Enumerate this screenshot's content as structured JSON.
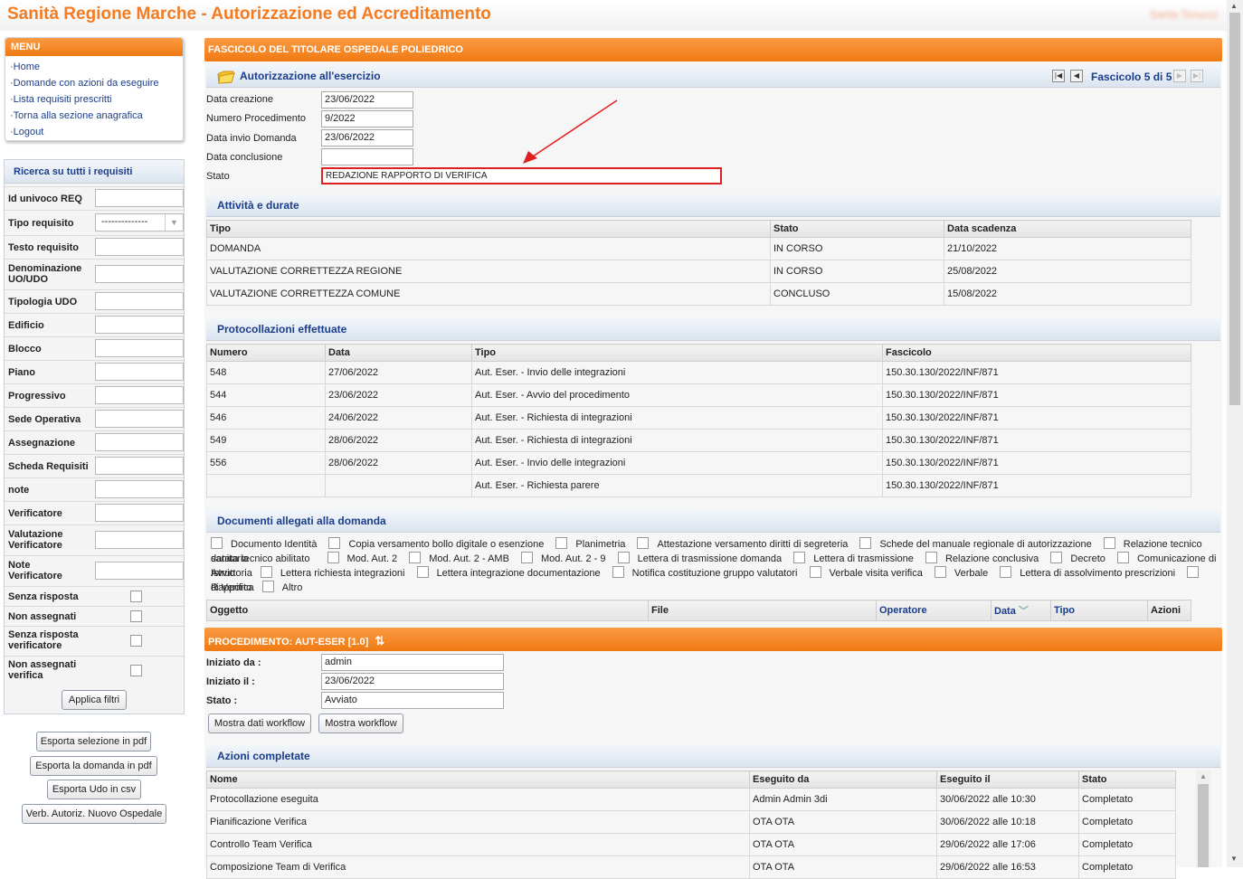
{
  "app": {
    "title": "Sanità Regione Marche - Autorizzazione ed Accreditamento",
    "user": "Santa Tonucci"
  },
  "menu": {
    "title": "MENU",
    "items": [
      "Home",
      "Domande con azioni da eseguire",
      "Lista requisiti prescritti",
      "Torna alla sezione anagrafica",
      "Logout"
    ]
  },
  "filters": {
    "title": "Ricerca su tutti i requisiti",
    "fields": [
      "Id univoco REQ",
      "Tipo requisito",
      "Testo requisito",
      "Denominazione UO/UDO",
      "Tipologia UDO",
      "Edificio",
      "Blocco",
      "Piano",
      "Progressivo",
      "Sede Operativa",
      "Assegnazione",
      "Scheda Requisiti",
      "note",
      "Verificatore",
      "Valutazione Verificatore",
      "Note Verificatore"
    ],
    "tipo_requisito_value": "--------------",
    "checks": [
      "Senza risposta",
      "Non assegnati",
      "Senza risposta verificatore",
      "Non assegnati verifica"
    ],
    "apply": "Applica filtri"
  },
  "side_buttons": [
    "Esporta selezione in pdf",
    "Esporta la domanda in pdf",
    "Esporta Udo in csv",
    "Verb. Autoriz. Nuovo Ospedale"
  ],
  "fascicolo": {
    "title": "FASCICOLO DEL TITOLARE OSPEDALE POLIEDRICO",
    "section": "Autorizzazione all'esercizio",
    "pager": "Fascicolo 5 di 5",
    "fields": [
      {
        "label": "Data creazione",
        "value": "23/06/2022"
      },
      {
        "label": "Numero Procedimento",
        "value": "9/2022"
      },
      {
        "label": "Data invio Domanda",
        "value": "23/06/2022"
      },
      {
        "label": "Data conclusione",
        "value": ""
      },
      {
        "label": "Stato",
        "value": "REDAZIONE RAPPORTO DI VERIFICA"
      }
    ]
  },
  "attivita": {
    "title": "Attività e durate",
    "columns": [
      "Tipo",
      "Stato",
      "Data scadenza"
    ],
    "rows": [
      [
        "DOMANDA",
        "IN CORSO",
        "21/10/2022"
      ],
      [
        "VALUTAZIONE CORRETTEZZA REGIONE",
        "IN CORSO",
        "25/08/2022"
      ],
      [
        "VALUTAZIONE CORRETTEZZA COMUNE",
        "CONCLUSO",
        "15/08/2022"
      ]
    ]
  },
  "protocollazioni": {
    "title": "Protocollazioni effettuate",
    "columns": [
      "Numero",
      "Data",
      "Tipo",
      "Fascicolo"
    ],
    "rows": [
      [
        "548",
        "27/06/2022",
        "Aut. Eser. - Invio delle integrazioni",
        "150.30.130/2022/INF/871"
      ],
      [
        "544",
        "23/06/2022",
        "Aut. Eser. - Avvio del procedimento",
        "150.30.130/2022/INF/871"
      ],
      [
        "546",
        "24/06/2022",
        "Aut. Eser. - Richiesta di integrazioni",
        "150.30.130/2022/INF/871"
      ],
      [
        "549",
        "28/06/2022",
        "Aut. Eser. - Richiesta di integrazioni",
        "150.30.130/2022/INF/871"
      ],
      [
        "556",
        "28/06/2022",
        "Aut. Eser. - Invio delle integrazioni",
        "150.30.130/2022/INF/871"
      ],
      [
        "",
        "",
        "Aut. Eser. - Richiesta parere",
        "150.30.130/2022/INF/871"
      ]
    ]
  },
  "documenti": {
    "title": "Documenti allegati alla domanda",
    "lines": [
      {
        "prefix": "",
        "items": [
          "Documento Identità",
          "Copia versamento bollo digitale o esenzione",
          "Planimetria",
          "Attestazione versamento diritti di segreteria",
          "Schede del manuale regionale di autorizzazione",
          "Relazione tecnico sanitaria"
        ]
      },
      {
        "prefix": "datata tecnico abilitato",
        "items": [
          "Mod. Aut. 2",
          "Mod. Aut. 2 - AMB",
          "Mod. Aut. 2 - 9",
          "Lettera di trasmissione domanda",
          "Lettera di trasmissione",
          "Relazione conclusiva",
          "Decreto",
          "Comunicazione di Avvio"
        ]
      },
      {
        "prefix": "Istruttoria",
        "items": [
          "Lettera richiesta integrazioni",
          "Lettera integrazione documentazione",
          "Notifica costituzione gruppo valutatori",
          "Verbale visita verifica",
          "Verbale",
          "Lettera di assolvimento prescrizioni",
          "Rapporto"
        ]
      },
      {
        "prefix": "di Verifica",
        "items": [
          "Altro"
        ]
      }
    ],
    "columns": [
      "Oggetto",
      "File",
      "Operatore",
      "Data",
      "Tipo",
      "Azioni"
    ]
  },
  "procedimento": {
    "title": "PROCEDIMENTO: AUT-ESER [1.0]",
    "fields": [
      {
        "label": "Iniziato da :",
        "value": "admin"
      },
      {
        "label": "Iniziato il :",
        "value": "23/06/2022"
      },
      {
        "label": "Stato :",
        "value": "Avviato"
      }
    ],
    "buttons": [
      "Mostra dati workflow",
      "Mostra workflow"
    ]
  },
  "azioni": {
    "title": "Azioni completate",
    "columns": [
      "Nome",
      "Eseguito da",
      "Eseguito il",
      "Stato"
    ],
    "rows": [
      [
        "Protocollazione eseguita",
        "Admin Admin 3di",
        "30/06/2022 alle 10:30",
        "Completato"
      ],
      [
        "Pianificazione Verifica",
        "OTA OTA",
        "30/06/2022 alle 10:18",
        "Completato"
      ],
      [
        "Controllo Team Verifica",
        "OTA OTA",
        "29/06/2022 alle 17:06",
        "Completato"
      ],
      [
        "Composizione Team di Verifica",
        "OTA OTA",
        "29/06/2022 alle 16:53",
        "Completato"
      ]
    ]
  },
  "colors": {
    "orange": "#f47b20",
    "blue_text": "#1a3d8c",
    "annotation_red": "#e02020"
  }
}
